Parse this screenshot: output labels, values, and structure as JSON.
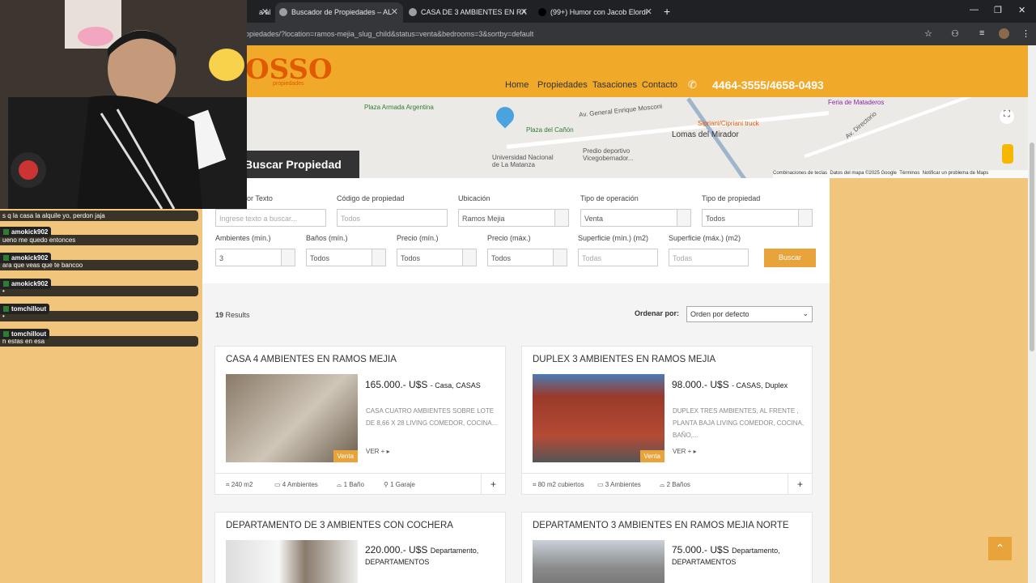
{
  "browser": {
    "tabs": [
      {
        "label": "a al"
      },
      {
        "label": "Buscador de Propiedades – AL"
      },
      {
        "label": "CASA DE 3 AMBIENTES EN RA"
      },
      {
        "label": "(99+) Humor con Jacob Elordi"
      }
    ],
    "new_tab": "+",
    "url": "ropiedades/?location=ramos-mejia_slug_child&status=venta&bedrooms=3&sortby=default"
  },
  "chat": [
    {
      "type": "msg",
      "text": "s q la casa la alquile yo, perdon jaja"
    },
    {
      "type": "msg",
      "text": "ueno me quedo entonces"
    },
    {
      "type": "user",
      "text": "amokick902"
    },
    {
      "type": "msg",
      "text": "ara que veas que te bancoo"
    },
    {
      "type": "user",
      "text": "amokick902"
    },
    {
      "type": "msg",
      "text": "•"
    },
    {
      "type": "user",
      "text": "amokick902"
    },
    {
      "type": "msg",
      "text": "•"
    },
    {
      "type": "user",
      "text": "tomchillout"
    },
    {
      "type": "msg",
      "text": "h esfas en esa"
    }
  ],
  "site": {
    "logo": "OSSO",
    "logo_sub": "propiedades",
    "nav": [
      "Home",
      "Propiedades",
      "Tasaciones",
      "Contacto"
    ],
    "phone": "4464-3555/4658-0493",
    "map_labels": [
      "Plaza Armada Argentina",
      "Plaza del Cañón",
      "Lomas del Mirador",
      "Universidad Nacional de La Matanza",
      "Predio deportivo Vicegobernador...",
      "Feria de Mataderos",
      "Sipriani/Cipriani truck",
      "Av. General Enrique Mosconi",
      "Av. Directorio",
      "Combinaciones de teclas",
      "Datos del mapa ©2025 Google",
      "Términos",
      "Notificar un problema de Maps"
    ],
    "buscar_title": "Buscar Propiedad",
    "filters_row1": [
      {
        "label": "or Texto",
        "value": "Ingrese texto a buscar...",
        "placeholder": true
      },
      {
        "label": "Código de propiedad",
        "value": "Todos",
        "placeholder": true
      },
      {
        "label": "Ubicación",
        "value": "Ramos Mejia",
        "select": true
      },
      {
        "label": "Tipo de operación",
        "value": "Venta",
        "select": true
      },
      {
        "label": "Tipo de propiedad",
        "value": "Todos",
        "select": true
      }
    ],
    "filters_row2": [
      {
        "label": "Ambientes (mín.)",
        "value": "3",
        "select": true
      },
      {
        "label": "Baños (mín.)",
        "value": "Todos",
        "select": true
      },
      {
        "label": "Precio (mín.)",
        "value": "Todos",
        "select": true
      },
      {
        "label": "Precio (máx.)",
        "value": "Todos",
        "select": true
      },
      {
        "label": "Superficie (mín.) (m2)",
        "value": "Todas",
        "placeholder": true
      },
      {
        "label": "Superficie (máx.) (m2)",
        "value": "Todas",
        "placeholder": true
      }
    ],
    "search_button": "Buscar",
    "results_count": "19",
    "results_word": "Results",
    "sort_label": "Ordenar por:",
    "sort_value": "Orden por defecto",
    "cards": [
      {
        "title": "CASA 4 AMBIENTES EN RAMOS MEJIA",
        "price": "165.000.- U$S",
        "type": "- Casa, CASAS",
        "desc": "CASA CUATRO AMBIENTES SOBRE LOTE DE 8,66 X 28  LIVING COMEDOR, COCINA...",
        "more": "VER + ▸",
        "tag": "Venta",
        "features": [
          "240 m2",
          "4 Ambientes",
          "1 Baño",
          "1 Garaje"
        ]
      },
      {
        "title": "DUPLEX 3 AMBIENTES EN RAMOS MEJIA",
        "price": "98.000.- U$S",
        "type": "- CASAS, Duplex",
        "desc": "DUPLEX TRES AMBIENTES, AL FRENTE , PLANTA BAJA LIVING COMEDOR, COCINA, BAÑO,...",
        "more": "VER + ▸",
        "tag": "Venta",
        "features": [
          "80 m2 cubiertos",
          "3 Ambientes",
          "2 Baños"
        ]
      },
      {
        "title": "DEPARTAMENTO DE 3 AMBIENTES CON COCHERA",
        "price": "220.000.- U$S",
        "type": "Departamento, DEPARTAMENTOS"
      },
      {
        "title": "DEPARTAMENTO 3 AMBIENTES EN RAMOS MEJIA NORTE",
        "price": "75.000.- U$S",
        "type": "Departamento, DEPARTAMENTOS"
      }
    ],
    "plus": "+",
    "scroll_top": "⌃"
  },
  "colors": {
    "accent": "#f0a928",
    "button": "#e8a33a",
    "panel": "#f2c57c"
  }
}
